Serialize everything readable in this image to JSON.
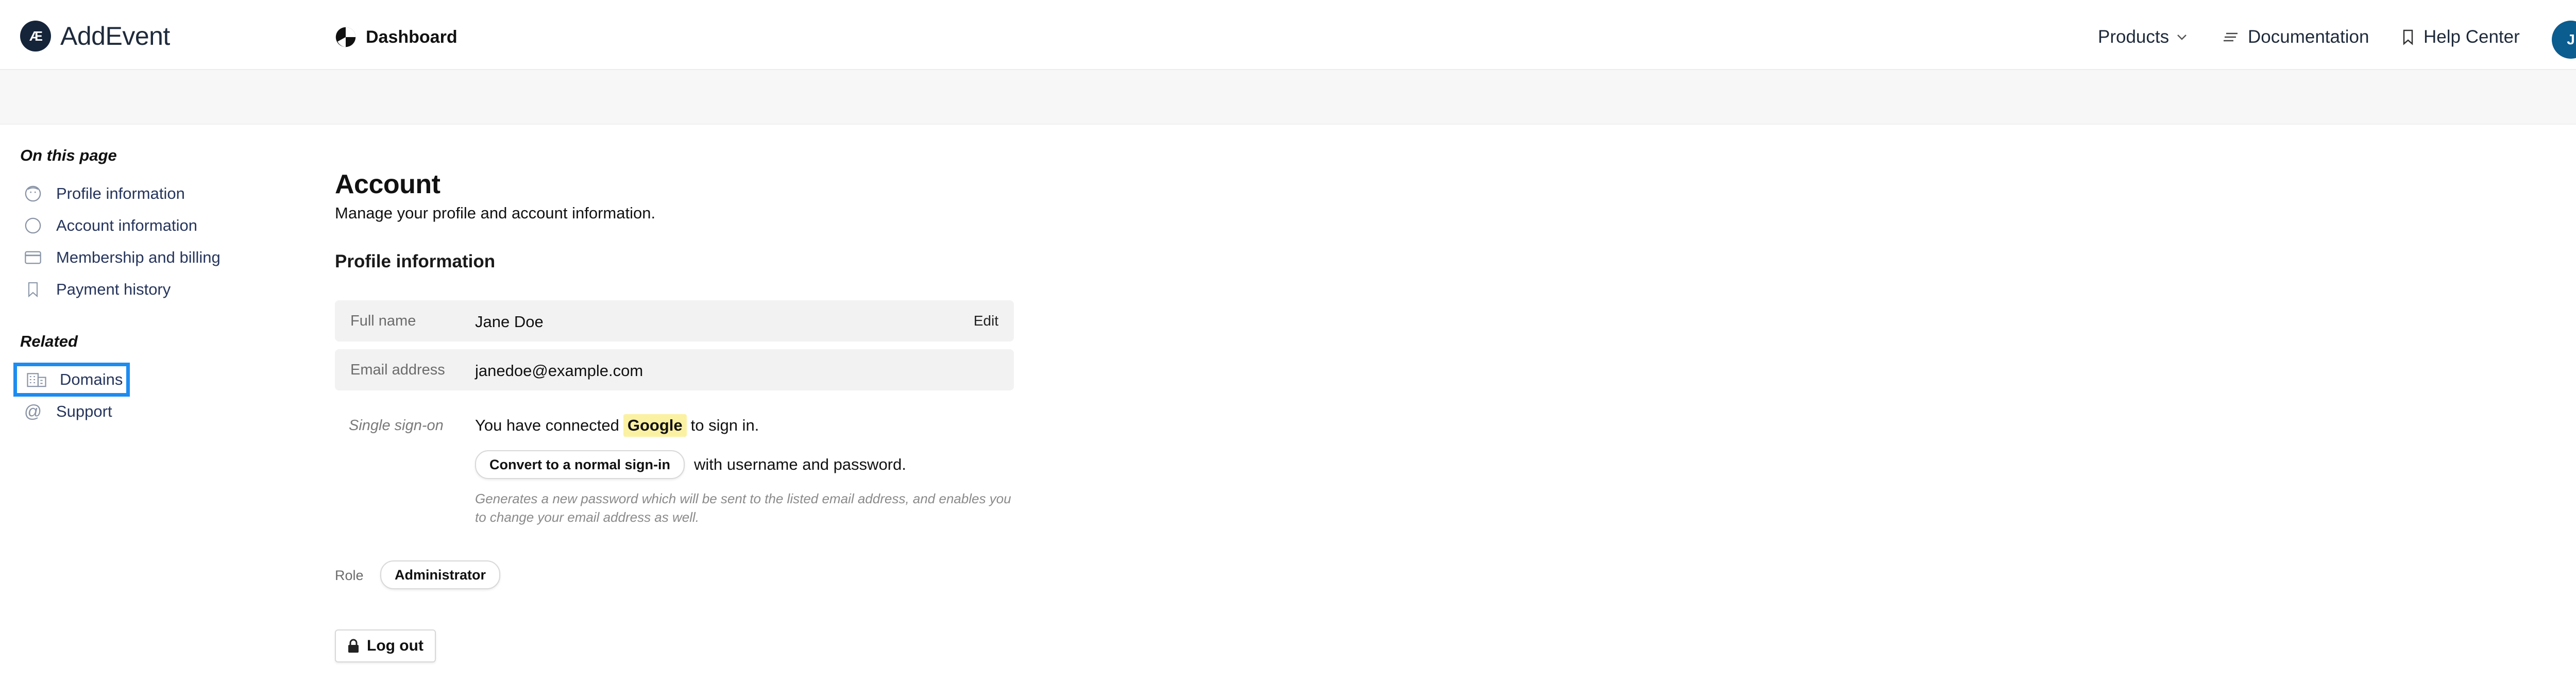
{
  "brand": {
    "name": "AddEvent",
    "logo_text": "Æ"
  },
  "header": {
    "section": "Dashboard",
    "nav": {
      "products": "Products",
      "documentation": "Documentation",
      "help_center": "Help Center"
    },
    "avatar_initial": "J"
  },
  "sidebar": {
    "on_this_page_title": "On this page",
    "on_this_page": [
      {
        "label": "Profile information",
        "icon": "smiley-icon"
      },
      {
        "label": "Account information",
        "icon": "circle-icon"
      },
      {
        "label": "Membership and billing",
        "icon": "credit-card-icon"
      },
      {
        "label": "Payment history",
        "icon": "bookmark-icon"
      }
    ],
    "related_title": "Related",
    "related": [
      {
        "label": "Domains",
        "icon": "building-icon",
        "active": true
      },
      {
        "label": "Support",
        "icon": "at-icon"
      }
    ]
  },
  "main": {
    "title": "Account",
    "subtitle": "Manage your profile and account information.",
    "profile_heading": "Profile information",
    "full_name": {
      "label": "Full name",
      "value": "Jane Doe",
      "action": "Edit"
    },
    "email": {
      "label": "Email address",
      "value": "janedoe@example.com"
    },
    "sso": {
      "label": "Single sign-on",
      "text_before": "You have connected",
      "provider": "Google",
      "text_after": "to sign in.",
      "convert_button": "Convert to a normal sign-in",
      "convert_after": "with username and password.",
      "hint": "Generates a new password which will be sent to the listed email address, and enables you to change your email address as well."
    },
    "role": {
      "label": "Role",
      "value": "Administrator"
    },
    "logout": "Log out"
  },
  "colors": {
    "accent": "#1d8cf0",
    "brand_dark": "#16243a",
    "avatar": "#0b5c8f",
    "highlight": "#fbf1a2",
    "link": "#26355c"
  }
}
